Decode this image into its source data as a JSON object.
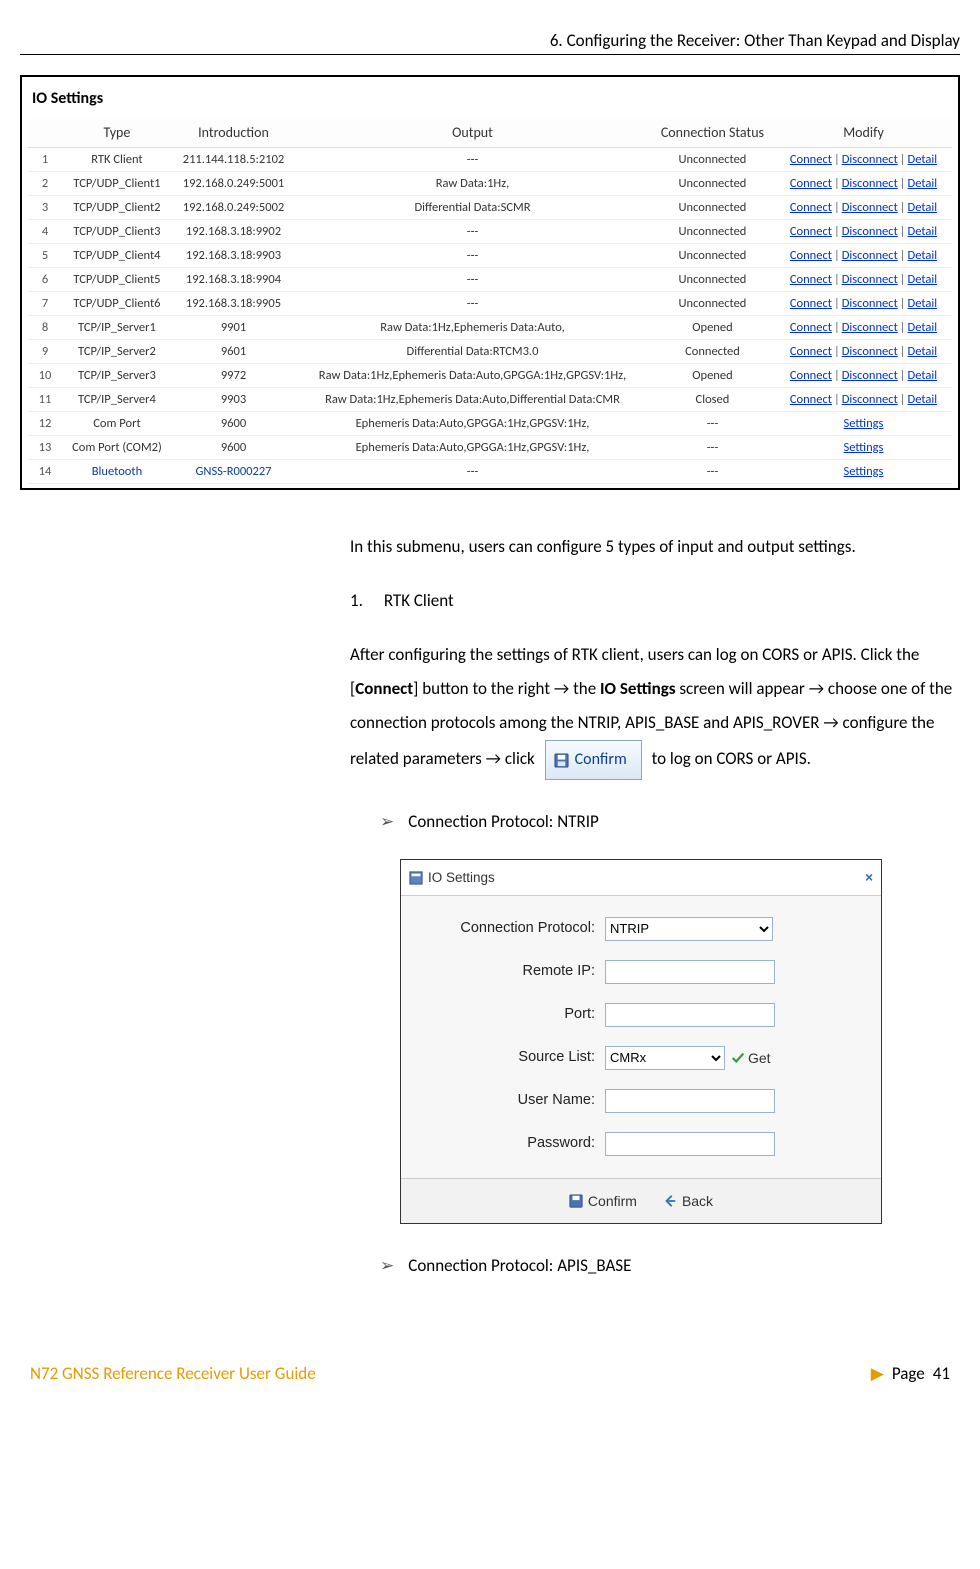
{
  "header": {
    "chapter": "6. Configuring the Receiver: Other Than Keypad and Display"
  },
  "io": {
    "title": "IO Settings",
    "columns": [
      "",
      "Type",
      "Introduction",
      "Output",
      "Connection Status",
      "Modify"
    ],
    "link_labels": {
      "connect": "Connect",
      "disconnect": "Disconnect",
      "detail": "Detail",
      "settings": "Settings"
    },
    "rows": [
      {
        "n": "1",
        "type": "RTK Client",
        "intro": "211.144.118.5:2102",
        "output": "---",
        "status": "Unconnected",
        "modify": "cdd"
      },
      {
        "n": "2",
        "type": "TCP/UDP_Client1",
        "intro": "192.168.0.249:5001",
        "output": "Raw Data:1Hz,",
        "status": "Unconnected",
        "modify": "cdd"
      },
      {
        "n": "3",
        "type": "TCP/UDP_Client2",
        "intro": "192.168.0.249:5002",
        "output": "Differential Data:SCMR",
        "status": "Unconnected",
        "modify": "cdd"
      },
      {
        "n": "4",
        "type": "TCP/UDP_Client3",
        "intro": "192.168.3.18:9902",
        "output": "---",
        "status": "Unconnected",
        "modify": "cdd"
      },
      {
        "n": "5",
        "type": "TCP/UDP_Client4",
        "intro": "192.168.3.18:9903",
        "output": "---",
        "status": "Unconnected",
        "modify": "cdd"
      },
      {
        "n": "6",
        "type": "TCP/UDP_Client5",
        "intro": "192.168.3.18:9904",
        "output": "---",
        "status": "Unconnected",
        "modify": "cdd"
      },
      {
        "n": "7",
        "type": "TCP/UDP_Client6",
        "intro": "192.168.3.18:9905",
        "output": "---",
        "status": "Unconnected",
        "modify": "cdd"
      },
      {
        "n": "8",
        "type": "TCP/IP_Server1",
        "intro": "9901",
        "output": "Raw Data:1Hz,Ephemeris Data:Auto,",
        "status": "Opened",
        "modify": "cdd"
      },
      {
        "n": "9",
        "type": "TCP/IP_Server2",
        "intro": "9601",
        "output": "Differential Data:RTCM3.0",
        "status": "Connected",
        "modify": "cdd"
      },
      {
        "n": "10",
        "type": "TCP/IP_Server3",
        "intro": "9972",
        "output": "Raw Data:1Hz,Ephemeris Data:Auto,GPGGA:1Hz,GPGSV:1Hz,",
        "status": "Opened",
        "modify": "cdd"
      },
      {
        "n": "11",
        "type": "TCP/IP_Server4",
        "intro": "9903",
        "output": "Raw Data:1Hz,Ephemeris Data:Auto,Differential Data:CMR",
        "status": "Closed",
        "modify": "cdd"
      },
      {
        "n": "12",
        "type": "Com Port",
        "intro": "9600",
        "output": "Ephemeris Data:Auto,GPGGA:1Hz,GPGSV:1Hz,",
        "status": "---",
        "modify": "settings"
      },
      {
        "n": "13",
        "type": "Com Port (COM2)",
        "intro": "9600",
        "output": "Ephemeris Data:Auto,GPGGA:1Hz,GPGSV:1Hz,",
        "status": "---",
        "modify": "settings"
      },
      {
        "n": "14",
        "type": "Bluetooth",
        "intro": "GNSS-R000227",
        "output": "---",
        "status": "---",
        "modify": "settings",
        "blue": true
      }
    ]
  },
  "text": {
    "intro": "In this submenu, users can configure 5 types of input and output settings.",
    "item1_num": "1.",
    "item1_title": "RTK Client",
    "para1_a": "After configuring the settings of RTK client, users can log on CORS or APIS. Click the [",
    "para1_connect": "Connect",
    "para1_b": "] button to the right → the ",
    "para1_io": "IO Settings",
    "para1_c": " screen will appear → choose one of the connection protocols among the NTRIP, APIS_BASE and APIS_ROVER → configure the related parameters → click ",
    "para1_d": " to log on CORS or APIS.",
    "confirm_label": "Confirm",
    "proto_ntrip": "Connection Protocol: NTRIP",
    "proto_apis": "Connection Protocol: APIS_BASE"
  },
  "dialog": {
    "title": "IO Settings",
    "fields": {
      "protocol": "Connection Protocol:",
      "remote_ip": "Remote IP:",
      "port": "Port:",
      "source": "Source List:",
      "user": "User Name:",
      "pass": "Password:"
    },
    "values": {
      "protocol": "NTRIP",
      "source": "CMRx",
      "get": "Get"
    },
    "buttons": {
      "confirm": "Confirm",
      "back": "Back"
    }
  },
  "footer": {
    "guide": "N72 GNSS Reference Receiver User Guide",
    "page_label": "Page",
    "page_num": "41"
  }
}
